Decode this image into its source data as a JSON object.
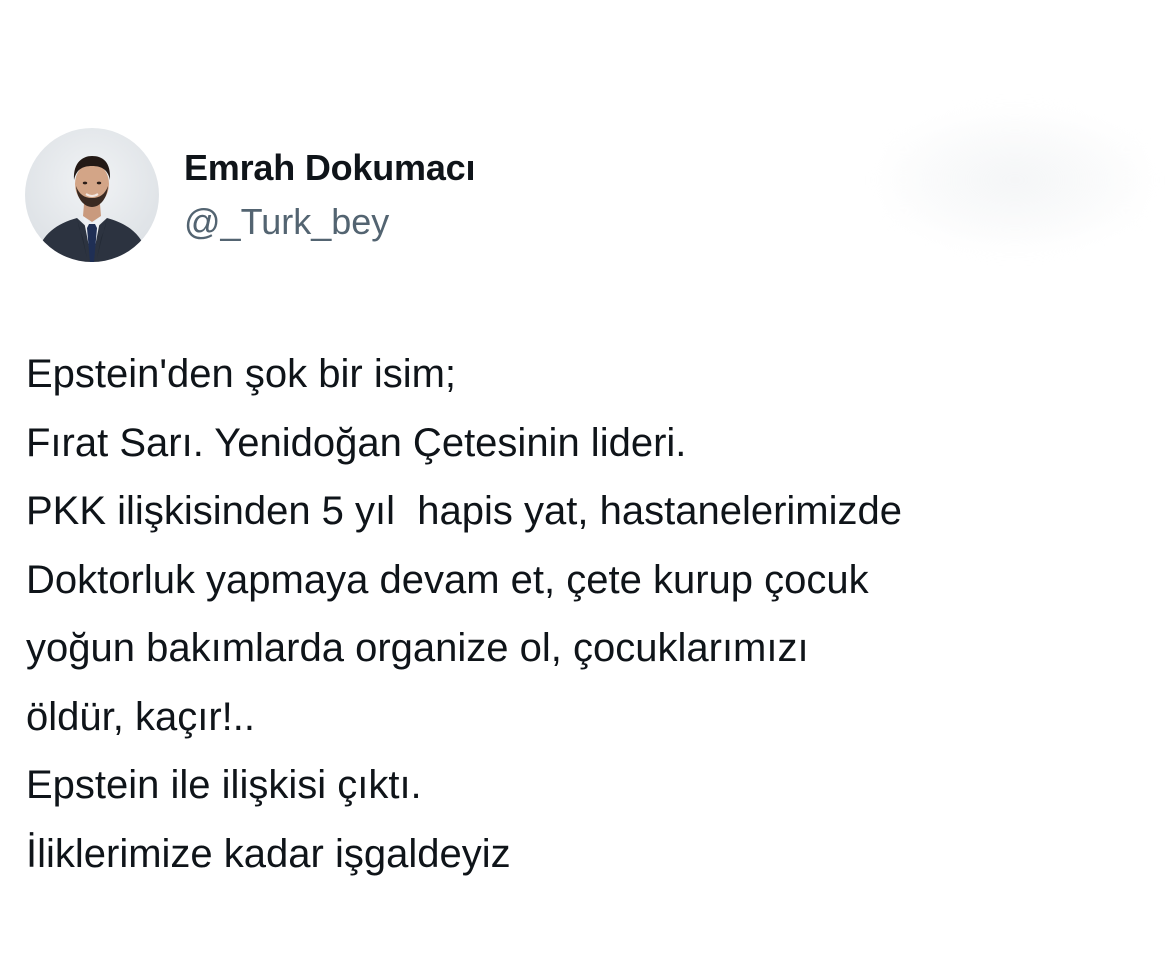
{
  "tweet": {
    "author": {
      "display_name": "Emrah Dokumacı",
      "handle": "@_Turk_bey"
    },
    "lines": [
      "Epstein'den şok bir isim;",
      "Fırat Sarı. Yenidoğan Çetesinin lideri.",
      "PKK ilişkisinden 5 yıl  hapis yat, hastanelerimizde",
      "Doktorluk yapmaya devam et, çete kurup çocuk",
      "yoğun bakımlarda organize ol, çocuklarımızı",
      "öldür, kaçır!..",
      "Epstein ile ilişkisi çıktı.",
      "İliklerimize kadar işgaldeyiz"
    ]
  },
  "colors": {
    "text_primary": "#0f1419",
    "text_secondary": "#536471",
    "background": "#ffffff"
  }
}
